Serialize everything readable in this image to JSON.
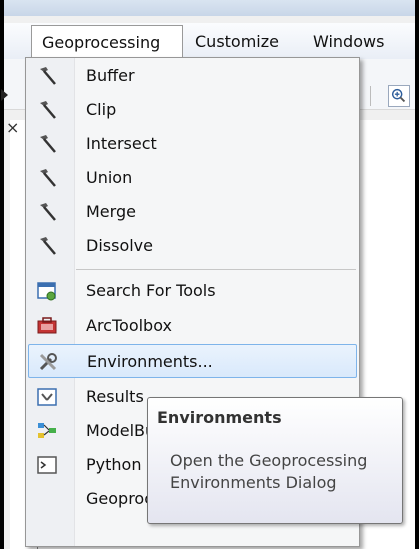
{
  "menubar": {
    "items": [
      {
        "label": "Geoprocessing",
        "open": true
      },
      {
        "label": "Customize"
      },
      {
        "label": "Windows"
      }
    ]
  },
  "menu": {
    "items": [
      {
        "label": "Buffer",
        "icon": "hammer-icon"
      },
      {
        "label": "Clip",
        "icon": "hammer-icon"
      },
      {
        "label": "Intersect",
        "icon": "hammer-icon"
      },
      {
        "label": "Union",
        "icon": "hammer-icon"
      },
      {
        "label": "Merge",
        "icon": "hammer-icon"
      },
      {
        "label": "Dissolve",
        "icon": "hammer-icon"
      },
      {
        "label": "Search For Tools",
        "icon": "search-window-icon"
      },
      {
        "label": "ArcToolbox",
        "icon": "toolbox-icon"
      },
      {
        "label": "Environments...",
        "icon": "tools-icon",
        "highlighted": true
      },
      {
        "label": "Results",
        "icon": "results-icon"
      },
      {
        "label": "ModelBuilder",
        "icon": "model-icon"
      },
      {
        "label": "Python",
        "icon": "python-window-icon"
      },
      {
        "label": "Geoprocessing Options...",
        "icon": ""
      }
    ]
  },
  "tooltip": {
    "title": "Environments",
    "body": "Open the Geoprocessing Environments Dialog"
  },
  "colors": {
    "highlight_border": "#7eb4ea",
    "highlight_fill": "#d9e9fb",
    "menu_bg": "#f5f6f7"
  }
}
